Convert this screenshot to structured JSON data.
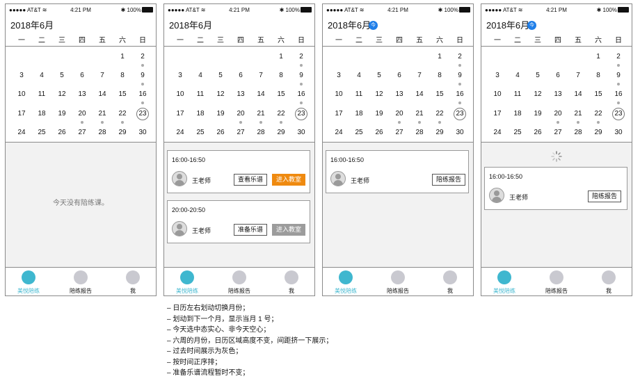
{
  "status": {
    "carrier": "●●●●● AT&T",
    "time": "4:21 PM",
    "battery": "100%"
  },
  "calendar": {
    "month": "2018年6月",
    "today_badge": "今",
    "weekdays": [
      "一",
      "二",
      "三",
      "四",
      "五",
      "六",
      "日"
    ],
    "weeks": [
      [
        "",
        "",
        "",
        "",
        "",
        "1",
        "2"
      ],
      [
        "3",
        "4",
        "5",
        "6",
        "7",
        "8",
        "9"
      ],
      [
        "10",
        "11",
        "12",
        "13",
        "14",
        "15",
        "16"
      ],
      [
        "17",
        "18",
        "19",
        "20",
        "21",
        "22",
        "23"
      ],
      [
        "24",
        "25",
        "26",
        "27",
        "28",
        "29",
        "30"
      ]
    ]
  },
  "screen1": {
    "empty_text": "今天没有陪练课。"
  },
  "lessons": [
    {
      "time": "16:00-16:50",
      "teacher": "王老师",
      "btn1": "查看乐谱",
      "btn2": "进入教室"
    },
    {
      "time": "20:00-20:50",
      "teacher": "王老师",
      "btn1": "准备乐谱",
      "btn2": "进入教室"
    }
  ],
  "report_button": "陪练报告",
  "tabs": [
    "美悦陪练",
    "陪练报告",
    "我"
  ],
  "notes": [
    "– 日历左右划动切换月份；",
    "– 划动到下一个月，显示当月 1 号；",
    "– 今天选中态实心、非今天空心；",
    "– 六周的月份，日历区域高度不变，间距挤一下展示；",
    "– 过去时间展示为灰色；",
    "– 按时间正序排；",
    "– 准备乐谱流程暂时不变；"
  ],
  "colors": {
    "accent": "#3fb7cf",
    "orange": "#ef8a10",
    "gray_button": "#9c9c9c",
    "badge_blue": "#1f7ee8"
  }
}
